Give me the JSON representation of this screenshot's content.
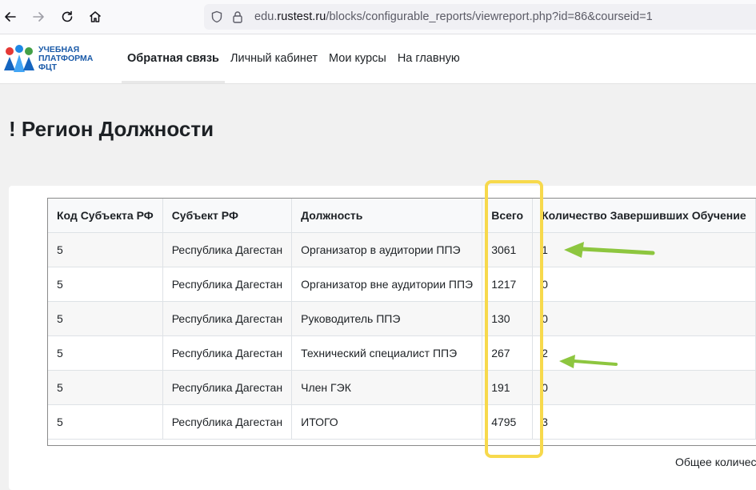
{
  "browser": {
    "url_prefix": "edu.",
    "url_domain": "rustest.ru",
    "url_path": "/blocks/configurable_reports/viewreport.php?id=86&courseid=1"
  },
  "logo": {
    "line1": "УЧЕБНАЯ",
    "line2": "ПЛАТФОРМА",
    "line3": "ФЦТ"
  },
  "nav": {
    "items": [
      {
        "label": "Обратная связь",
        "active": true
      },
      {
        "label": "Личный кабинет"
      },
      {
        "label": "Мои курсы"
      },
      {
        "label": "На главную"
      }
    ]
  },
  "page": {
    "title": "! Регион Должности"
  },
  "table": {
    "headers": [
      "Код Субъекта РФ",
      "Субъект РФ",
      "Должность",
      "Всего",
      "Количество Завершивших Обучение"
    ],
    "rows": [
      [
        "5",
        "Республика Дагестан",
        "Организатор в аудитории ППЭ",
        "3061",
        "1"
      ],
      [
        "5",
        "Республика Дагестан",
        "Организатор вне аудитории ППЭ",
        "1217",
        "0"
      ],
      [
        "5",
        "Республика Дагестан",
        "Руководитель ППЭ",
        "130",
        "0"
      ],
      [
        "5",
        "Республика Дагестан",
        "Технический специалист ППЭ",
        "267",
        "2"
      ],
      [
        "5",
        "Республика Дагестан",
        "Член ГЭК",
        "191",
        "0"
      ],
      [
        "5",
        "Республика Дагестан",
        "ИТОГО",
        "4795",
        "3"
      ]
    ]
  },
  "footer": {
    "text": "Общее количес"
  },
  "colors": {
    "highlight": "#f7d94c",
    "arrow": "#8dc63f",
    "logo_blue": "#1a5aa8"
  }
}
